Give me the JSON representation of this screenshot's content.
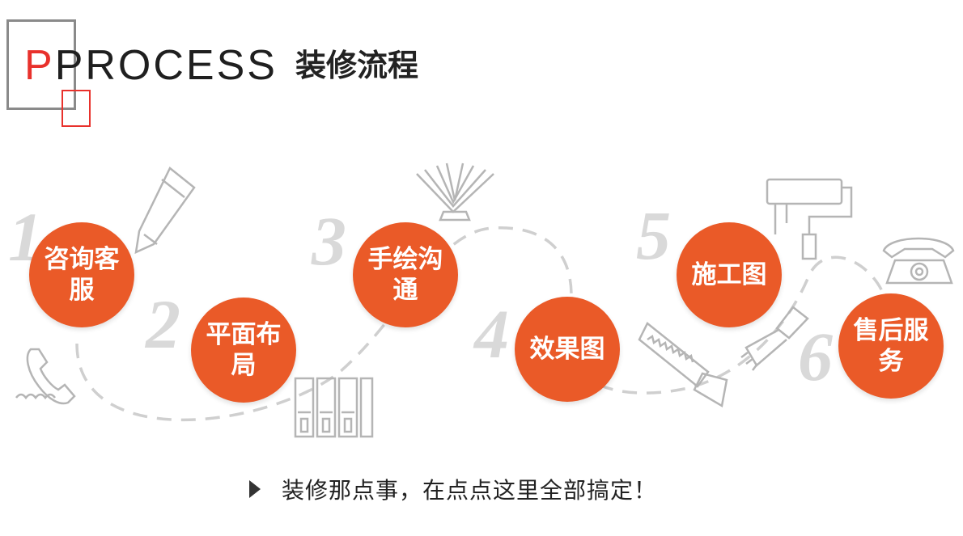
{
  "header": {
    "title_first_letter": "P",
    "title_main": "PROCESS",
    "title_cn": "装修流程",
    "accent_color": "#e8312c",
    "frame_color": "#8a8a8a"
  },
  "steps": [
    {
      "number": "1",
      "label": "咨询客服"
    },
    {
      "number": "2",
      "label": "平面布局"
    },
    {
      "number": "3",
      "label": "手绘沟通"
    },
    {
      "number": "4",
      "label": "效果图"
    },
    {
      "number": "5",
      "label": "施工图"
    },
    {
      "number": "6",
      "label": "售后服务"
    }
  ],
  "step_color": "#ea5a28",
  "icons": [
    "phone-icon",
    "pencil-icon",
    "door-panels-icon",
    "book-icon",
    "saw-icon",
    "paint-roller-icon",
    "brush-icon",
    "telephone-icon"
  ],
  "footer": {
    "text": "装修那点事，在点点这里全部搞定！"
  }
}
